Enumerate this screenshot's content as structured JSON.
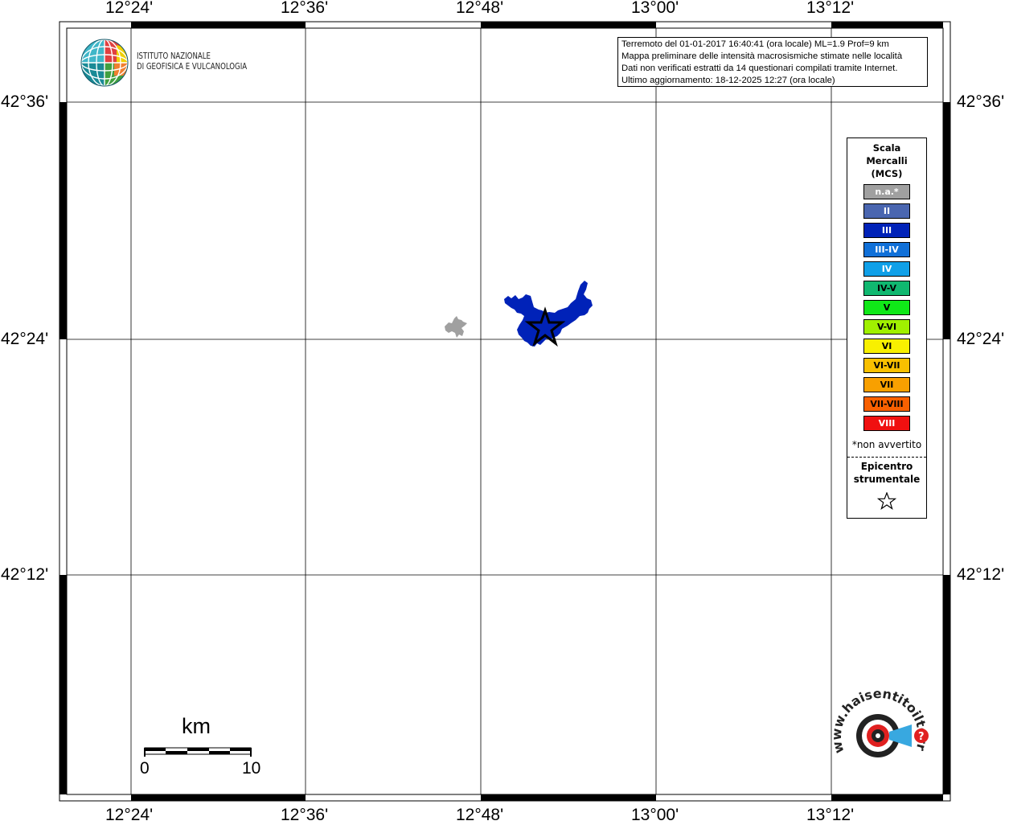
{
  "map": {
    "lon_labels": [
      "12°24'",
      "12°36'",
      "12°48'",
      "13°00'",
      "13°12'"
    ],
    "lat_labels": [
      "42°36'",
      "42°24'",
      "42°12'"
    ]
  },
  "institute": {
    "line1": "ISTITUTO NAZIONALE",
    "line2": "DI GEOFISICA E VULCANOLOGIA"
  },
  "info": {
    "line1": "Terremoto del 01-01-2017 16:40:41 (ora locale) ML=1.9 Prof=9 km",
    "line2": "Mappa preliminare delle intensità macrosismiche stimate nelle località",
    "line3": "Dati non verificati estratti da 14 questionari compilati tramite Internet.",
    "line4": "Ultimo aggiornamento: 18-12-2025 12:27 (ora locale)"
  },
  "legend": {
    "title1": "Scala",
    "title2": "Mercalli",
    "title3": "(MCS)",
    "items": [
      {
        "label": "n.a.*",
        "color": "#a0a0a0"
      },
      {
        "label": "II",
        "color": "#4a66b0"
      },
      {
        "label": "III",
        "color": "#0022b8"
      },
      {
        "label": "III-IV",
        "color": "#1070d8"
      },
      {
        "label": "IV",
        "color": "#10a0e8"
      },
      {
        "label": "IV-V",
        "color": "#10b870"
      },
      {
        "label": "V",
        "color": "#10e818"
      },
      {
        "label": "V-VI",
        "color": "#a0f000"
      },
      {
        "label": "VI",
        "color": "#f8f000"
      },
      {
        "label": "VI-VII",
        "color": "#f8c000"
      },
      {
        "label": "VII",
        "color": "#f8a000"
      },
      {
        "label": "VII-VIII",
        "color": "#f86000"
      },
      {
        "label": "VIII",
        "color": "#f01010"
      }
    ],
    "note": "*non avvertito",
    "epicentre1": "Epicentro",
    "epicentre2": "strumentale"
  },
  "scale_bar": {
    "unit": "km",
    "start": "0",
    "end": "10"
  },
  "logo2_text": "www.haisentitoilterremoto.it"
}
